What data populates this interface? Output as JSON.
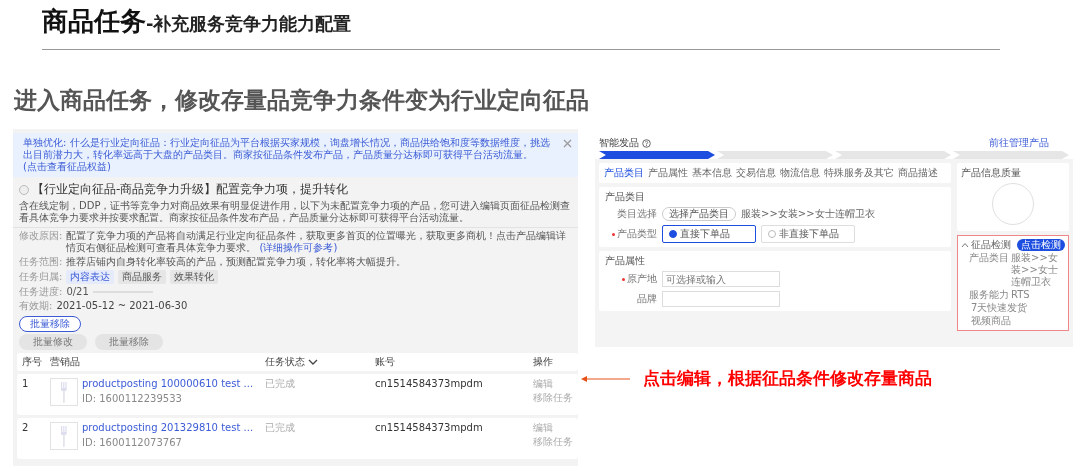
{
  "slide": {
    "title": "商品任务",
    "title_suffix": "-补充服务竞争力能力配置",
    "heading": "进入商品任务，修改存量品竞争力条件变为行业定向征品"
  },
  "task_page": {
    "notice": {
      "text": "单独优化: 什么是行业定向征品：行业定向征品为平台根据买家规模，询盘增长情况，商品供给饱和度等数据维度，挑选出目前潜力大，转化率远高于大盘的产品类目。商家按征品条件发布产品，产品质量分达标即可获得平台活动流量。",
      "link": "(点击查看征品权益)"
    },
    "task": {
      "selected": false,
      "title": "【行业定向征品-商品竞争力升级】配置竞争力项，提升转化",
      "description": "含在线定制，DDP，证书等竞争力对商品效果有明显促进作用，以下为未配置竞争力项的产品，您可进入编辑页面征品检测查看具体竞争力要求并按要求配置。商家按征品条件发布产品，产品质量分达标即可获得平台活动流量。"
    },
    "details": [
      {
        "label": "修改原因:",
        "text": "配置了竞争力项的产品将自动满足行业定向征品条件，获取更多首页的位置曝光，获取更多商机！点击产品编辑详情页右侧征品检测可查看具体竞争力要求。",
        "link": "(详细操作可参考)"
      },
      {
        "label": "任务范围:",
        "text": "推荐店铺内自身转化率较高的产品，预测配置竞争力项，转化率将大幅提升。"
      }
    ],
    "tags_label": "任务归属:",
    "tags": [
      {
        "label": "内容表达",
        "selected": true
      },
      {
        "label": "商品服务",
        "selected": false
      },
      {
        "label": "效果转化",
        "selected": false
      }
    ],
    "progress": {
      "label": "任务进度:",
      "value": "0/21",
      "level": 0
    },
    "validity": {
      "label": "有效期:",
      "value": "2021-05-12 ~ 2021-06-30"
    },
    "remove_button": "批量移除",
    "bulk_buttons": [
      {
        "label": "批量修改",
        "disabled": true
      },
      {
        "label": "批量移除",
        "disabled": true
      }
    ],
    "table": {
      "columns": [
        {
          "label": "序号",
          "sortable": false
        },
        {
          "label": "营销品",
          "sortable": false
        },
        {
          "label": "任务状态",
          "sortable": true
        },
        {
          "label": "账号",
          "sortable": false
        },
        {
          "label": "操作",
          "sortable": false
        }
      ],
      "rows": [
        {
          "index": "1",
          "product": "productposting 100000610 test ...",
          "product_id": "ID: 1600112239533",
          "status": "已完成",
          "account": "cn1514584373mpdm",
          "actions": [
            "编辑",
            "移除任务"
          ]
        },
        {
          "index": "2",
          "product": "productposting 201329810 test ...",
          "product_id": "ID: 1600112073767",
          "status": "已完成",
          "account": "cn1514584373mpdm",
          "actions": [
            "编辑",
            "移除任务"
          ]
        }
      ]
    }
  },
  "product_form": {
    "title": "智能发品",
    "manage_link": "前往管理产品",
    "steps": [
      {
        "selected": true
      },
      {
        "selected": false
      },
      {
        "selected": false
      },
      {
        "selected": false
      }
    ],
    "tabs": [
      {
        "label": "产品类目",
        "selected": true
      },
      {
        "label": "产品属性",
        "selected": false
      },
      {
        "label": "基本信息",
        "selected": false
      },
      {
        "label": "交易信息",
        "selected": false
      },
      {
        "label": "物流信息",
        "selected": false
      },
      {
        "label": "特殊服务及其它",
        "selected": false
      },
      {
        "label": "商品描述",
        "selected": false
      }
    ],
    "category_section": {
      "title": "产品类目",
      "category_label": "类目选择",
      "category_button": "选择产品类目",
      "category_path": "服装>>女装>>女士连帽卫衣",
      "type_label": "产品类型",
      "type_options": [
        {
          "label": "直接下单品",
          "selected": true
        },
        {
          "label": "非直接下单品",
          "selected": false
        }
      ]
    },
    "attribute_section": {
      "title": "产品属性",
      "fields": [
        {
          "label": "原产地",
          "required": true,
          "placeholder": "可选择或输入"
        },
        {
          "label": "品牌",
          "required": false
        }
      ]
    },
    "quality_card": {
      "title": "产品信息质量"
    },
    "check_box": {
      "title": "征品检测",
      "expanded": true,
      "button": "点击检测",
      "rows": [
        {
          "label": "产品类目",
          "value": "服装>>女装>>女士连帽卫衣"
        },
        {
          "label": "服务能力",
          "value": "RTS"
        },
        {
          "value": "7天快速发货"
        },
        {
          "value": "视频商品"
        }
      ]
    }
  },
  "annotation": {
    "text": "点击编辑，根据征品条件修改存量商品"
  }
}
